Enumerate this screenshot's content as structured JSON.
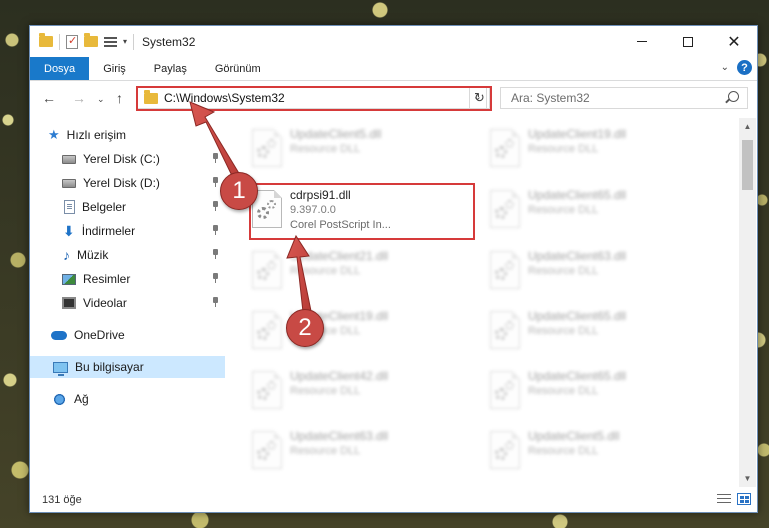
{
  "window": {
    "title": "System32"
  },
  "ribbon": {
    "tabs": [
      "Dosya",
      "Giriş",
      "Paylaş",
      "Görünüm"
    ],
    "help_label": "?"
  },
  "navigation": {
    "address": "C:\\Windows\\System32",
    "search_placeholder": "Ara: System32"
  },
  "sidebar": {
    "items": [
      {
        "label": "Hızlı erişim",
        "icon": "star-icon",
        "pinned": false
      },
      {
        "label": "Yerel Disk (C:)",
        "icon": "drive-icon",
        "pinned": true
      },
      {
        "label": "Yerel Disk (D:)",
        "icon": "drive-icon",
        "pinned": true
      },
      {
        "label": "Belgeler",
        "icon": "document-icon",
        "pinned": true
      },
      {
        "label": "İndirmeler",
        "icon": "download-icon",
        "pinned": true
      },
      {
        "label": "Müzik",
        "icon": "music-icon",
        "pinned": true
      },
      {
        "label": "Resimler",
        "icon": "pictures-icon",
        "pinned": true
      },
      {
        "label": "Videolar",
        "icon": "videos-icon",
        "pinned": true
      },
      {
        "label": "OneDrive",
        "icon": "cloud-icon",
        "pinned": false
      },
      {
        "label": "Bu bilgisayar",
        "icon": "computer-icon",
        "pinned": false,
        "selected": true
      },
      {
        "label": "Ağ",
        "icon": "network-icon",
        "pinned": false
      }
    ]
  },
  "files": {
    "left_column": [
      {
        "name": "UpdateClient5.dll",
        "type": "Resource DLL",
        "blurred": true
      },
      {
        "name": "cdrpsi91.dll",
        "version": "9.397.0.0",
        "description": "Corel PostScript In...",
        "blurred": false
      },
      {
        "name": "UpdateClient21.dll",
        "type": "Resource DLL",
        "blurred": true
      },
      {
        "name": "UpdateClient19.dll",
        "type": "Resource DLL",
        "blurred": true
      },
      {
        "name": "UpdateClient42.dll",
        "type": "Resource DLL",
        "blurred": true
      },
      {
        "name": "UpdateClient63.dll",
        "type": "Resource DLL",
        "blurred": true
      }
    ],
    "right_column": [
      {
        "name": "UpdateClient19.dll",
        "type": "Resource DLL"
      },
      {
        "name": "UpdateClient65.dll",
        "type": "Resource DLL"
      },
      {
        "name": "UpdateClient63.dll",
        "type": "Resource DLL"
      },
      {
        "name": "UpdateClient65.dll",
        "type": "Resource DLL"
      },
      {
        "name": "UpdateClient65.dll",
        "type": "Resource DLL"
      },
      {
        "name": "UpdateClient5.dll",
        "type": "Resource DLL"
      }
    ]
  },
  "status": {
    "count": "131 öğe"
  },
  "annotations": {
    "step1": "1",
    "step2": "2",
    "color": "#c84a45"
  },
  "colors": {
    "accent": "#1979ca",
    "highlight": "#d63a3a",
    "selection": "#cce8ff"
  }
}
